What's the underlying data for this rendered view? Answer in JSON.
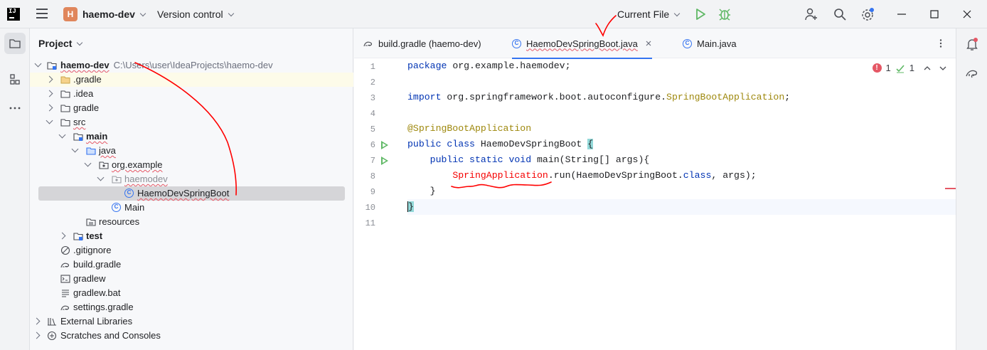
{
  "titlebar": {
    "logo": "IJ",
    "project_badge": "H",
    "project_name": "haemo-dev",
    "vcs_label": "Version control",
    "run_config": "Current File",
    "icons": [
      "menu-icon",
      "run-icon",
      "debug-icon",
      "add-user-icon",
      "search-icon",
      "settings-icon",
      "minimize-icon",
      "maximize-icon",
      "close-icon"
    ]
  },
  "left_toolbar": {
    "icons": [
      "folder-icon",
      "structure-icon",
      "more-icon"
    ]
  },
  "right_toolbar": {
    "icons": [
      "notifications-icon",
      "gradle-icon"
    ]
  },
  "project_panel": {
    "title": "Project",
    "tree": [
      {
        "label": "haemo-dev",
        "path": "C:\\Users\\user\\IdeaProjects\\haemo-dev",
        "icon": "module-icon",
        "bold": true,
        "expanded": true
      },
      {
        "label": ".gradle",
        "icon": "folder-icon",
        "expanded": false
      },
      {
        "label": ".idea",
        "icon": "folder-icon",
        "expanded": false
      },
      {
        "label": "gradle",
        "icon": "folder-icon",
        "expanded": false
      },
      {
        "label": "src",
        "icon": "folder-icon",
        "expanded": true
      },
      {
        "label": "main",
        "icon": "module-folder-icon",
        "bold": true,
        "expanded": true
      },
      {
        "label": "java",
        "icon": "source-folder-icon",
        "expanded": true
      },
      {
        "label": "org.example",
        "icon": "package-icon",
        "expanded": true
      },
      {
        "label": "haemodev",
        "icon": "package-icon",
        "expanded": true
      },
      {
        "label": "HaemoDevSpringBoot",
        "icon": "class-icon",
        "selected": true
      },
      {
        "label": "Main",
        "icon": "class-icon"
      },
      {
        "label": "resources",
        "icon": "resources-folder-icon"
      },
      {
        "label": "test",
        "icon": "module-folder-icon",
        "bold": true,
        "expanded": false
      },
      {
        "label": ".gitignore",
        "icon": "ignore-file-icon"
      },
      {
        "label": "build.gradle",
        "icon": "gradle-file-icon"
      },
      {
        "label": "gradlew",
        "icon": "shell-file-icon"
      },
      {
        "label": "gradlew.bat",
        "icon": "text-file-icon"
      },
      {
        "label": "settings.gradle",
        "icon": "gradle-file-icon"
      },
      {
        "label": "External Libraries",
        "icon": "library-icon",
        "expanded": false
      },
      {
        "label": "Scratches and Consoles",
        "icon": "scratches-icon",
        "expanded": false
      }
    ]
  },
  "editor": {
    "tabs": [
      {
        "label": "build.gradle (haemo-dev)",
        "icon": "gradle-file-icon",
        "active": false
      },
      {
        "label": "HaemoDevSpringBoot.java",
        "icon": "class-icon",
        "active": true,
        "closable": true
      },
      {
        "label": "Main.java",
        "icon": "class-icon",
        "active": false
      }
    ],
    "inspections": {
      "errors": "1",
      "warnings": "1"
    },
    "line_numbers": [
      "1",
      "2",
      "3",
      "4",
      "5",
      "6",
      "7",
      "8",
      "9",
      "10",
      "11"
    ],
    "code": {
      "l1_kw": "package",
      "l1_rest": " org.example.haemodev;",
      "l3_kw": "import",
      "l3_pkg": " org.springframework.boot.autoconfigure.",
      "l3_cls": "SpringBootApplication",
      "l3_end": ";",
      "l5_ann": "@SpringBootApplication",
      "l6_kw": "public class",
      "l6_name": " HaemoDevSpringBoot ",
      "l6_brace": "{",
      "l7_indent": "    ",
      "l7_kw": "public static void",
      "l7_rest": " main(String[] args){",
      "l8_indent": "        ",
      "l8_err": "SpringApplication",
      "l8_mid": ".run(HaemoDevSpringBoot.",
      "l8_kw": "class",
      "l8_end": ", args);",
      "l9": "    }",
      "l10": "}"
    }
  },
  "colors": {
    "accent": "#3574f0",
    "keyword": "#0033b3",
    "annotation": "#9e880d",
    "error": "#f50000",
    "run_green": "#5fb865",
    "project_badge": "#e0865c",
    "annotation_ink": "#ff0000"
  }
}
